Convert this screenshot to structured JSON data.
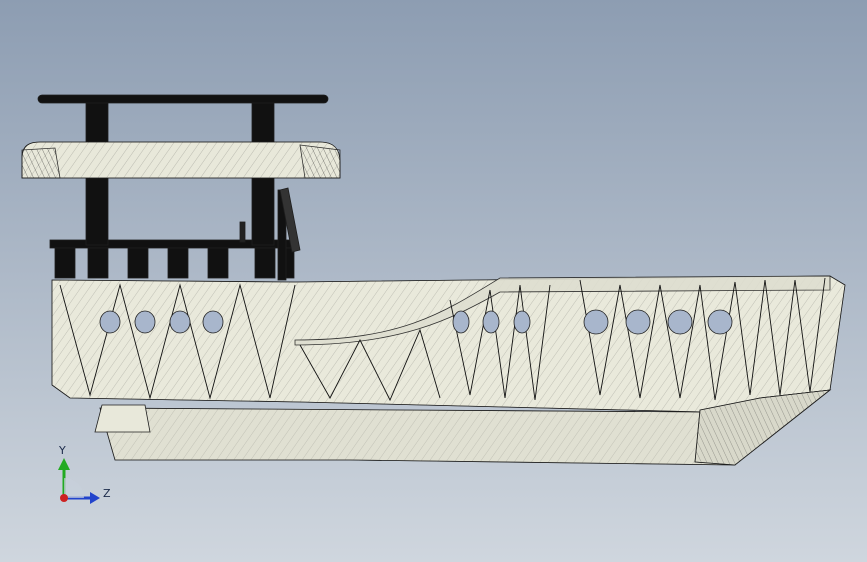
{
  "viewport": {
    "background_top": "#8d9db2",
    "background_bottom": "#cfd6de",
    "model_fill": "#e6e6d8",
    "edge_color": "#1e1e1e"
  },
  "triad": {
    "y_label": "Y",
    "z_label": "Z",
    "y_color": "#22aa22",
    "z_color": "#2244cc",
    "x_color": "#cc2222"
  }
}
